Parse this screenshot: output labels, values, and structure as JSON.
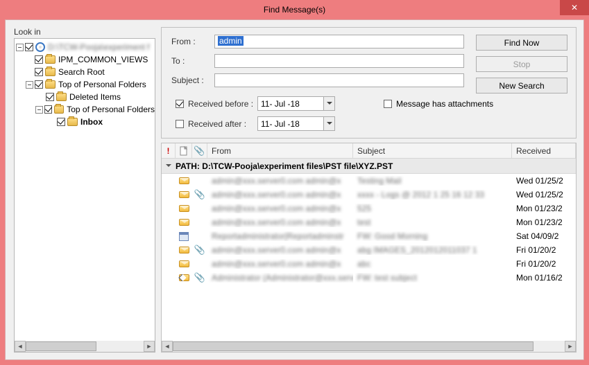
{
  "window": {
    "title": "Find Message(s)"
  },
  "tree": {
    "label": "Look in",
    "root": "D:\\TCW-Pooja\\experiment files\\PST file\\XYZ.PST",
    "nodes": {
      "ipm": "IPM_COMMON_VIEWS",
      "search": "Search Root",
      "top": "Top of Personal Folders",
      "deleted": "Deleted Items",
      "top2": "Top of Personal Folders",
      "inbox": "Inbox"
    }
  },
  "form": {
    "from_label": "From :",
    "from_value": "admin",
    "to_label": "To :",
    "to_value": "",
    "subject_label": "Subject :",
    "subject_value": "",
    "received_before_label": "Received before :",
    "received_before_value": "11- Jul -18",
    "received_before_checked": true,
    "received_after_label": "Received after :",
    "received_after_value": "11- Jul -18",
    "received_after_checked": false,
    "attachments_label": "Message has attachments",
    "attachments_checked": false
  },
  "buttons": {
    "find": "Find Now",
    "stop": "Stop",
    "new": "New Search"
  },
  "columns": {
    "importance": "!",
    "from": "From",
    "subject": "Subject",
    "received": "Received"
  },
  "group_header": "PATH: D:\\TCW-Pooja\\experiment files\\PST file\\XYZ.PST",
  "rows": [
    {
      "icon": "env",
      "attach": false,
      "from": "admin@xxx.server0.com admin@x",
      "subject": "Testing Mail",
      "received": "Wed 01/25/2"
    },
    {
      "icon": "env",
      "attach": true,
      "from": "admin@xxx.server0.com admin@x",
      "subject": "xxxx - Logs @ 2012 1 25 16 12 33",
      "received": "Wed 01/25/2"
    },
    {
      "icon": "env",
      "attach": false,
      "from": "admin@xxx.server0.com admin@x",
      "subject": "525",
      "received": "Mon 01/23/2"
    },
    {
      "icon": "env",
      "attach": false,
      "from": "admin@xxx.server0.com admin@x",
      "subject": "test",
      "received": "Mon 01/23/2"
    },
    {
      "icon": "cal",
      "attach": false,
      "from": "Reportadministrator|Reportadminstr",
      "subject": "FW: Good Morning",
      "received": "Sat 04/09/2"
    },
    {
      "icon": "env",
      "attach": true,
      "from": "admin@xxx.server0.com admin@x",
      "subject": "abg IMAGES_2012012011037 1",
      "received": "Fri 01/20/2"
    },
    {
      "icon": "env",
      "attach": false,
      "from": "admin@xxx.server0.com admin@x",
      "subject": "abc",
      "received": "Fri 01/20/2"
    },
    {
      "icon": "reply",
      "attach": true,
      "from": "Administrator (Administrator@xxx.serve",
      "subject": "FW: test subject",
      "received": "Mon 01/16/2"
    }
  ]
}
